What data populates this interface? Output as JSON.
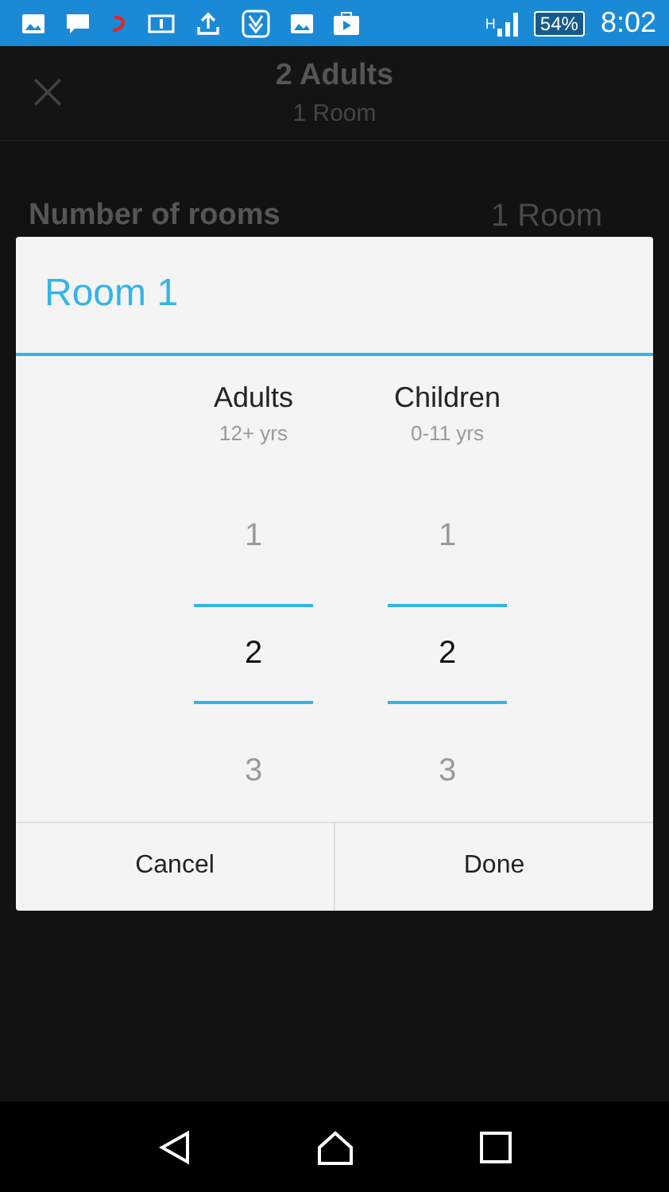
{
  "status_bar": {
    "network": "H",
    "battery": "54%",
    "time": "8:02"
  },
  "header": {
    "title": "2 Adults",
    "subtitle": "1 Room"
  },
  "rooms_row": {
    "label": "Number of rooms",
    "value": "1 Room"
  },
  "dialog": {
    "title": "Room 1",
    "pickers": [
      {
        "label": "Adults",
        "sublabel": "12+ yrs",
        "values": [
          {
            "text": "1",
            "selected": false
          },
          {
            "text": "2",
            "selected": true
          },
          {
            "text": "3",
            "selected": false
          }
        ]
      },
      {
        "label": "Children",
        "sublabel": "0-11 yrs",
        "values": [
          {
            "text": "1",
            "selected": false
          },
          {
            "text": "2",
            "selected": true
          },
          {
            "text": "3",
            "selected": false
          }
        ]
      }
    ],
    "buttons": [
      "Cancel",
      "Done"
    ]
  }
}
